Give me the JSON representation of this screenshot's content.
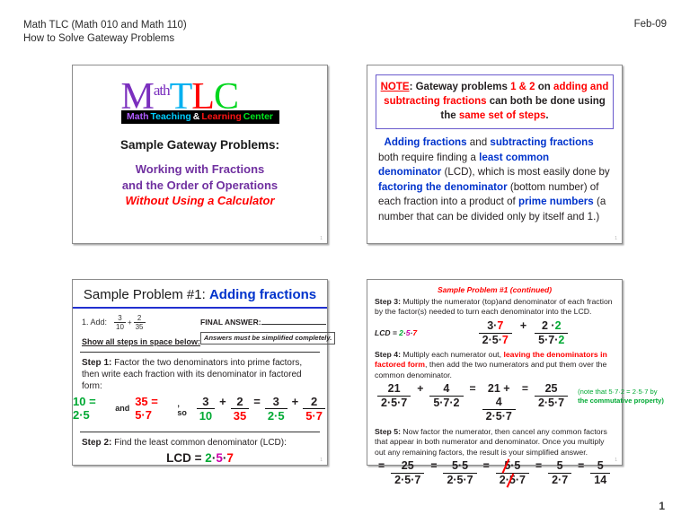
{
  "header": {
    "line1": "Math TLC (Math 010 and Math 110)",
    "line2": "How to Solve Gateway Problems",
    "date": "Feb-09"
  },
  "page_number": "1",
  "slide_mark": "1",
  "slide1": {
    "logo": {
      "m": "M",
      "ath": "ath",
      "t": "T",
      "l": "L",
      "c": "C",
      "bar_math": "Math",
      "bar_teaching": "Teaching",
      "bar_amp": "&",
      "bar_learning": "Learning",
      "bar_center": "Center"
    },
    "title": "Sample Gateway Problems:",
    "line1": "Working with Fractions",
    "line2": "and the Order of Operations",
    "line3": "Without Using a Calculator"
  },
  "slide2": {
    "note_label": "NOTE",
    "note_colon": ":",
    "note_t1": "Gateway problems",
    "note_r1": "1 & 2",
    "note_t2": "on",
    "note_r2": "adding and subtracting fractions",
    "note_t3": "can both be done using the",
    "note_r3": "same set of steps",
    "note_period": ".",
    "body": {
      "b1": "Adding fractions",
      "t1": "and",
      "b2": "subtracting fractions",
      "t2": "both require finding a",
      "b3": "least common denominator",
      "t3": "(LCD), which is most easily done by",
      "b4": "factoring the denominator",
      "t4": "(bottom number) of each fraction into a product of",
      "b5": "prime numbers",
      "t5": "(a number that can be divided only by itself and 1.)"
    }
  },
  "slide3": {
    "title_plain": "Sample Problem #1:",
    "title_blue": "Adding fractions",
    "problem_label": "1. Add:",
    "frac1_num": "3",
    "frac1_den": "10",
    "plus": "+",
    "frac2_num": "2",
    "frac2_den": "35",
    "show_steps": "Show all steps in space below:",
    "final_answer_label": "FINAL ANSWER:",
    "answer_note": "Answers must be simplified completely.",
    "step1_label": "Step 1:",
    "step1_text": "Factor the two denominators into prime factors, then write each fraction with its denominator in factored form:",
    "fact1": "10 = 2·5",
    "and": "and",
    "fact2": "35 = 5·7",
    "so": ", so",
    "m_n1": "3",
    "m_d1": "10",
    "m_op1": "+",
    "m_n2": "2",
    "m_d2": "35",
    "m_eq": "=",
    "m_n3": "3",
    "m_d3": "2·5",
    "m_op2": "+",
    "m_n4": "2",
    "m_d4": "5·7",
    "step2_label": "Step 2:",
    "step2_text": "Find the least common denominator (LCD):",
    "lcd_label": "LCD =",
    "lcd_2": "2",
    "lcd_dot1": "·",
    "lcd_5": "5",
    "lcd_dot2": "·",
    "lcd_7": "7"
  },
  "slide4": {
    "title": "Sample Problem #1 (continued)",
    "step3_label": "Step 3:",
    "step3_text": "Multiply the numerator (top)and denominator of each fraction by the factor(s) needed to turn each denominator into the LCD.",
    "lcd_small_label": "LCD =",
    "lcd_small_2": "2",
    "lcd_small_5": "5",
    "lcd_small_7": "7",
    "s3_n1a": "3·",
    "s3_n1b": "7",
    "s3_d1a": "2·5·",
    "s3_d1b": "7",
    "s3_plus": "+",
    "s3_n2a": "2 ·",
    "s3_n2b": "2",
    "s3_d2a": "5·7·",
    "s3_d2b": "2",
    "step4_label": "Step 4:",
    "step4_t1": "Multiply each numerator out,",
    "step4_red": "leaving the denominators in factored form",
    "step4_t2": ", then add the two numerators and put them over the common denominator.",
    "s4_n1": "21",
    "s4_d1": "2·5·7",
    "s4_plus": "+",
    "s4_n2": "4",
    "s4_d2": "5·7·2",
    "s4_eq1": "=",
    "s4_n3": "21 + 4",
    "s4_d3": "2·5·7",
    "s4_eq2": "=",
    "s4_n4": "25",
    "s4_d4": "2·5·7",
    "note_l1": "(note that 5·7·2 = 2·5·7 by",
    "note_l2": "the commutative property)",
    "step5_label": "Step 5:",
    "step5_text": "Now factor the numerator, then cancel any common factors that appear in both numerator and denominator.  Once you multiply out any remaining factors, the result is your simplified answer.",
    "s5_eq0": "=",
    "s5_n1": "25",
    "s5_d1": "2·5·7",
    "s5_eq1": "=",
    "s5_n2": "5·5",
    "s5_d2": "2·5·7",
    "s5_eq2": "=",
    "s5_n3a": "5",
    "s5_n3b": "·5",
    "s5_d3a": "2·",
    "s5_d3b": "5",
    "s5_d3c": "·7",
    "s5_eq3": "=",
    "s5_n4": "5",
    "s5_d4": "2·7",
    "s5_eq4": "=",
    "s5_n5": "5",
    "s5_d5": "14"
  }
}
